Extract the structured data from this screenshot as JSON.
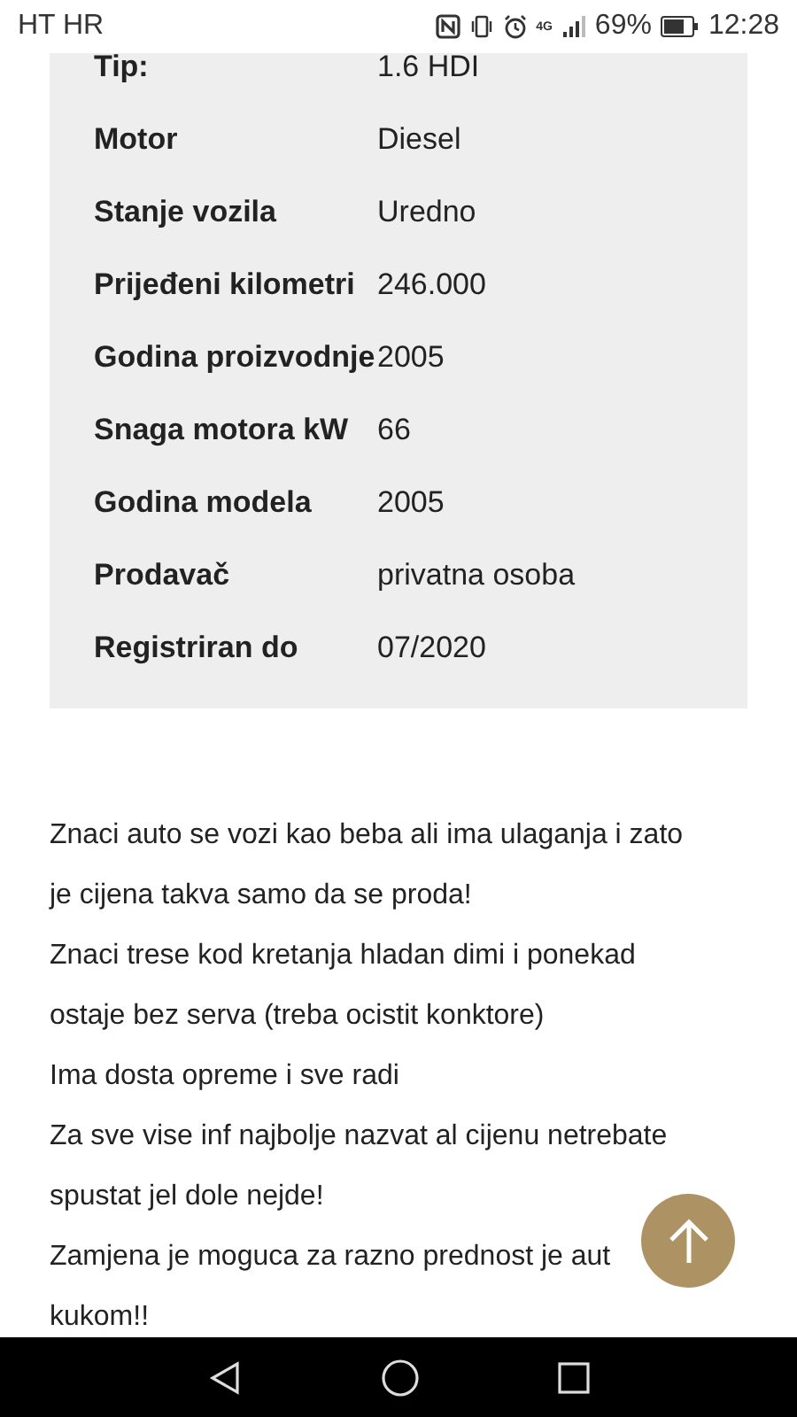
{
  "status_bar": {
    "carrier": "HT HR",
    "network": "4G",
    "battery": "69%",
    "time": "12:28"
  },
  "specs": [
    {
      "label": "Tip:",
      "value": "1.6 HDI"
    },
    {
      "label": "Motor",
      "value": "Diesel"
    },
    {
      "label": "Stanje vozila",
      "value": "Uredno"
    },
    {
      "label": "Prijeđeni kilometri",
      "value": "246.000"
    },
    {
      "label": "Godina proizvodnje",
      "value": "2005"
    },
    {
      "label": "Snaga motora kW",
      "value": "66"
    },
    {
      "label": "Godina modela",
      "value": "2005"
    },
    {
      "label": "Prodavač",
      "value": "privatna osoba"
    },
    {
      "label": "Registriran do",
      "value": "07/2020"
    }
  ],
  "description_lines": [
    "Znaci auto se vozi kao beba ali ima ulaganja i zato",
    "je cijena takva samo da se proda!",
    "Znaci trese kod kretanja hladan dimi i ponekad",
    "ostaje bez serva (treba ocistit konktore)",
    "Ima dosta opreme i sve radi",
    "Za sve vise inf najbolje nazvat al cijenu netrebate",
    "spustat jel dole nejde!",
    "Zamjena je moguca za razno prednost je aut",
    "kukom!!"
  ]
}
